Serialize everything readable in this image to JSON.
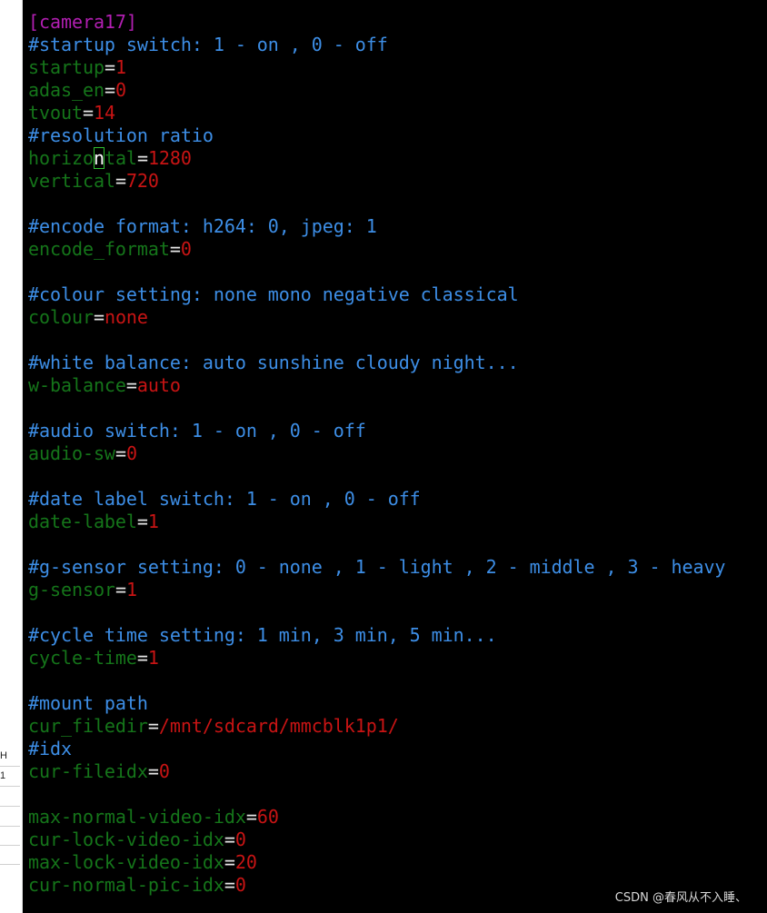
{
  "editor": {
    "lines": [
      {
        "type": "section",
        "text": "[camera17]"
      },
      {
        "type": "comment",
        "text": "#startup switch: 1 - on , 0 - off"
      },
      {
        "type": "kv",
        "key": "startup",
        "value": "1"
      },
      {
        "type": "kv",
        "key": "adas_en",
        "value": "0"
      },
      {
        "type": "kv",
        "key": "tvout",
        "value": "14"
      },
      {
        "type": "comment",
        "text": "#resolution ratio"
      },
      {
        "type": "kv_cursor",
        "key_before": "horizo",
        "cursor_char": "n",
        "key_after": "tal",
        "value": "1280"
      },
      {
        "type": "kv",
        "key": "vertical",
        "value": "720"
      },
      {
        "type": "blank"
      },
      {
        "type": "comment",
        "text": "#encode format: h264: 0, jpeg: 1"
      },
      {
        "type": "kv",
        "key": "encode_format",
        "value": "0"
      },
      {
        "type": "blank"
      },
      {
        "type": "comment",
        "text": "#colour setting: none mono negative classical"
      },
      {
        "type": "kv",
        "key": "colour",
        "value": "none"
      },
      {
        "type": "blank"
      },
      {
        "type": "comment",
        "text": "#white balance: auto sunshine cloudy night..."
      },
      {
        "type": "kv",
        "key": "w-balance",
        "value": "auto"
      },
      {
        "type": "blank"
      },
      {
        "type": "comment",
        "text": "#audio switch: 1 - on , 0 - off"
      },
      {
        "type": "kv",
        "key": "audio-sw",
        "value": "0"
      },
      {
        "type": "blank"
      },
      {
        "type": "comment",
        "text": "#date label switch: 1 - on , 0 - off"
      },
      {
        "type": "kv",
        "key": "date-label",
        "value": "1"
      },
      {
        "type": "blank"
      },
      {
        "type": "comment",
        "text": "#g-sensor setting: 0 - none , 1 - light , 2 - middle , 3 - heavy"
      },
      {
        "type": "kv",
        "key": "g-sensor",
        "value": "1"
      },
      {
        "type": "blank"
      },
      {
        "type": "comment",
        "text": "#cycle time setting: 1 min, 3 min, 5 min..."
      },
      {
        "type": "kv",
        "key": "cycle-time",
        "value": "1"
      },
      {
        "type": "blank"
      },
      {
        "type": "comment",
        "text": "#mount path"
      },
      {
        "type": "kv",
        "key": "cur_filedir",
        "value": "/mnt/sdcard/mmcblk1p1/"
      },
      {
        "type": "comment",
        "text": "#idx"
      },
      {
        "type": "kv",
        "key": "cur-fileidx",
        "value": "0"
      },
      {
        "type": "blank"
      },
      {
        "type": "kv",
        "key": "max-normal-video-idx",
        "value": "60"
      },
      {
        "type": "kv",
        "key": "cur-lock-video-idx",
        "value": "0"
      },
      {
        "type": "kv",
        "key": "max-lock-video-idx",
        "value": "20"
      },
      {
        "type": "kv",
        "key": "cur-normal-pic-idx",
        "value": "0"
      }
    ]
  },
  "left_panel": {
    "fragments": [
      "H",
      "1"
    ]
  },
  "watermark": {
    "text": "CSDN @春风从不入睡、"
  },
  "colors": {
    "background": "#000000",
    "section": "#b21fb2",
    "comment": "#3d8ee6",
    "key": "#15751a",
    "value": "#c81414",
    "equals": "#e6e6e6"
  }
}
